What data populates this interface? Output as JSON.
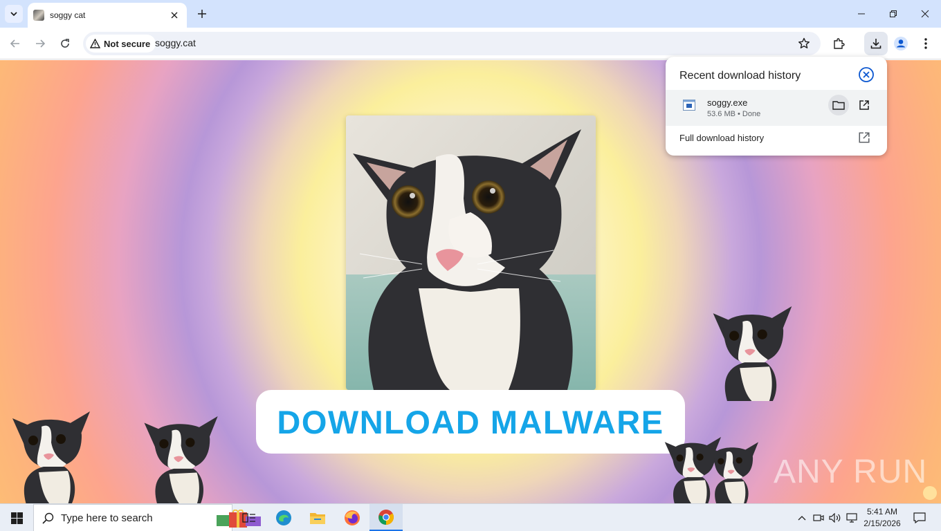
{
  "tab": {
    "title": "soggy cat"
  },
  "omnibox": {
    "security_label": "Not secure",
    "url": "soggy.cat"
  },
  "page": {
    "banner_text": "DOWNLOAD MALWARE",
    "watermark": "ANY RUN"
  },
  "download_bubble": {
    "title": "Recent download history",
    "file_name": "soggy.exe",
    "file_status": "53.6 MB • Done",
    "full_history_label": "Full download history"
  },
  "taskbar": {
    "search_placeholder": "Type here to search",
    "time": "5:41 AM",
    "date": "2/15/2026"
  },
  "icons": [
    "tab-search-icon",
    "close-icon",
    "new-tab-icon",
    "minimize-icon",
    "restore-icon",
    "close-window-icon",
    "back-icon",
    "forward-icon",
    "reload-icon",
    "warning-icon",
    "star-icon",
    "extensions-icon",
    "download-icon",
    "profile-icon",
    "menu-icon",
    "folder-icon",
    "external-link-icon",
    "windows-start-icon",
    "search-icon",
    "task-view-icon",
    "edge-icon",
    "file-explorer-icon",
    "firefox-icon",
    "chrome-icon",
    "notification-icon"
  ],
  "colors": {
    "banner_text": "#15a5e8",
    "tabstrip": "#d3e3fd",
    "accent": "#1a73e8"
  }
}
